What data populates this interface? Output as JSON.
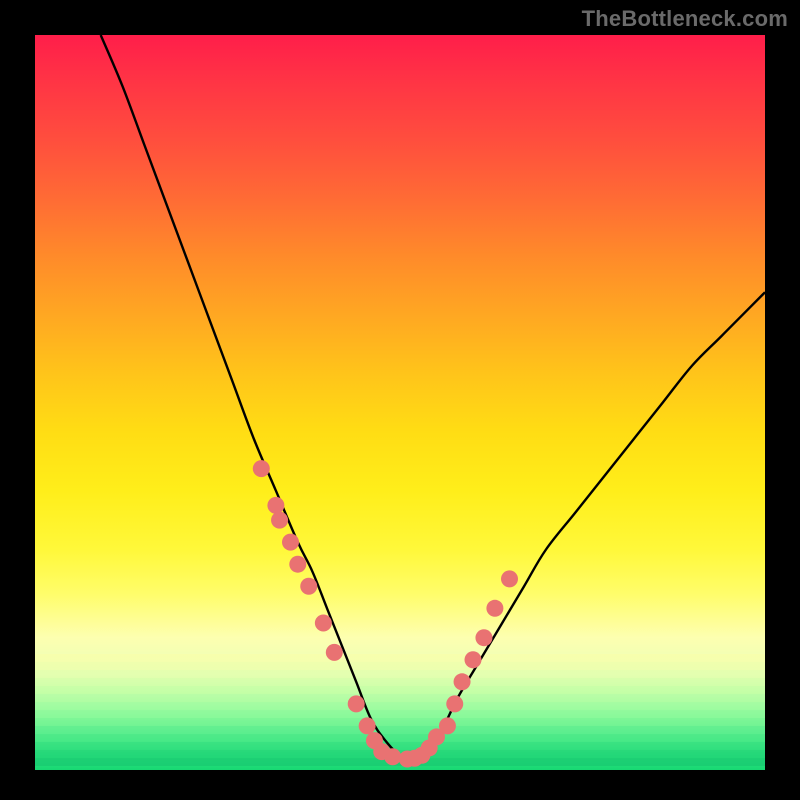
{
  "attribution": "TheBottleneck.com",
  "colors": {
    "curve": "#000000",
    "dot_fill": "#e97272",
    "dot_stroke": "#9e3b3b"
  },
  "chart_data": {
    "type": "line",
    "title": "",
    "xlabel": "",
    "ylabel": "",
    "xlim": [
      0,
      100
    ],
    "ylim": [
      0,
      100
    ],
    "series": [
      {
        "name": "bottleneck-curve",
        "x": [
          9,
          12,
          15,
          18,
          21,
          24,
          27,
          30,
          33,
          36,
          38,
          40,
          42,
          44,
          46,
          48,
          50,
          52,
          54,
          56,
          58,
          61,
          64,
          67,
          70,
          74,
          78,
          82,
          86,
          90,
          94,
          98,
          100
        ],
        "y": [
          100,
          93,
          85,
          77,
          69,
          61,
          53,
          45,
          38,
          31,
          27,
          22,
          17,
          12,
          7,
          4,
          2,
          1.5,
          3,
          6,
          10,
          15,
          20,
          25,
          30,
          35,
          40,
          45,
          50,
          55,
          59,
          63,
          65
        ]
      }
    ],
    "highlighted_points": {
      "name": "sample-dots",
      "x": [
        31,
        33,
        33.5,
        35,
        36,
        37.5,
        39.5,
        41,
        44,
        45.5,
        46.5,
        47.5,
        49,
        51,
        52,
        53,
        54,
        55,
        56.5,
        57.5,
        58.5,
        60,
        61.5,
        63,
        65
      ],
      "y": [
        41,
        36,
        34,
        31,
        28,
        25,
        20,
        16,
        9,
        6,
        4,
        2.5,
        1.8,
        1.5,
        1.6,
        2,
        3,
        4.5,
        6,
        9,
        12,
        15,
        18,
        22,
        26
      ]
    },
    "background_gradient": "red-to-green-vertical"
  }
}
